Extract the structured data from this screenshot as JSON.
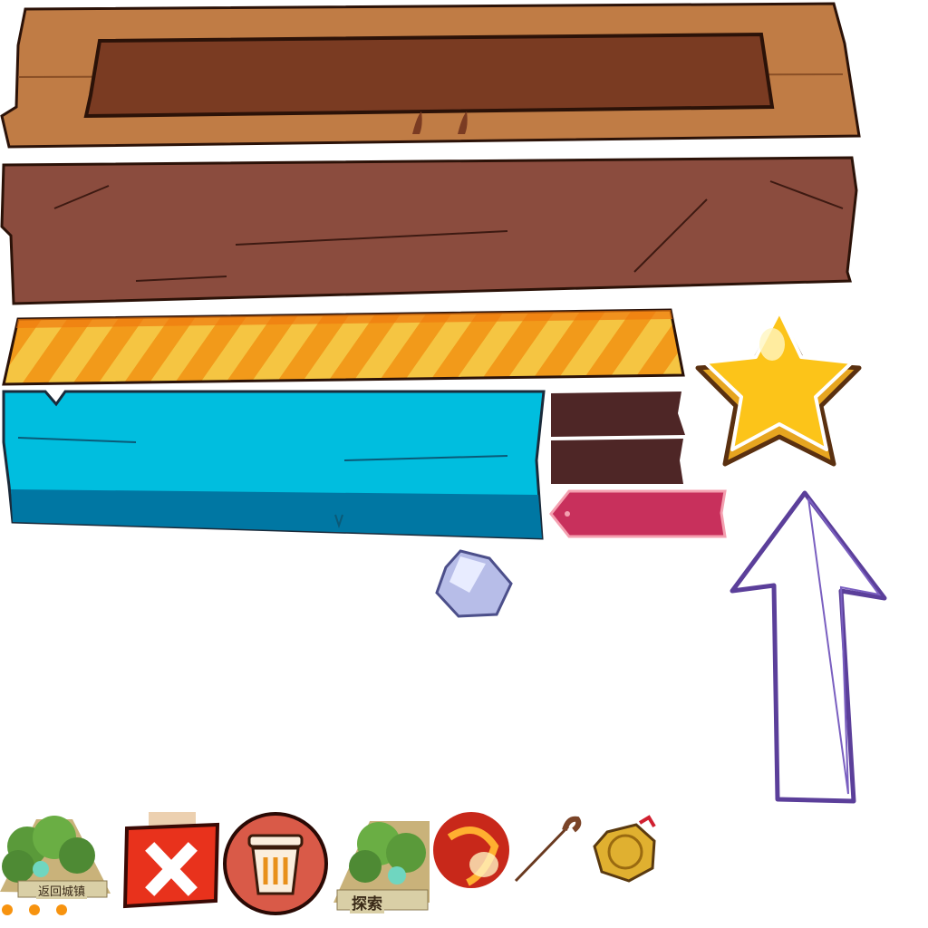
{
  "sprites": {
    "return_town_label": "返回城镇",
    "explore_label": "探索"
  },
  "colors": {
    "wood_light": "#c07c45",
    "wood_inner": "#7a3b22",
    "wood_brown": "#8b4c3e",
    "stripe_orange": "#f29a1a",
    "stripe_yellow": "#f5c542",
    "blue_plank": "#00bedf",
    "blue_plank_shadow": "#0077a3",
    "dark_plank": "#4e2626",
    "pink_tag": "#c8305c",
    "star_yellow": "#fcc419",
    "arrow_purple": "#5b3f9a",
    "close_red": "#e8321c",
    "trash_red": "#d95a48",
    "dot_orange": "#f7930f"
  }
}
